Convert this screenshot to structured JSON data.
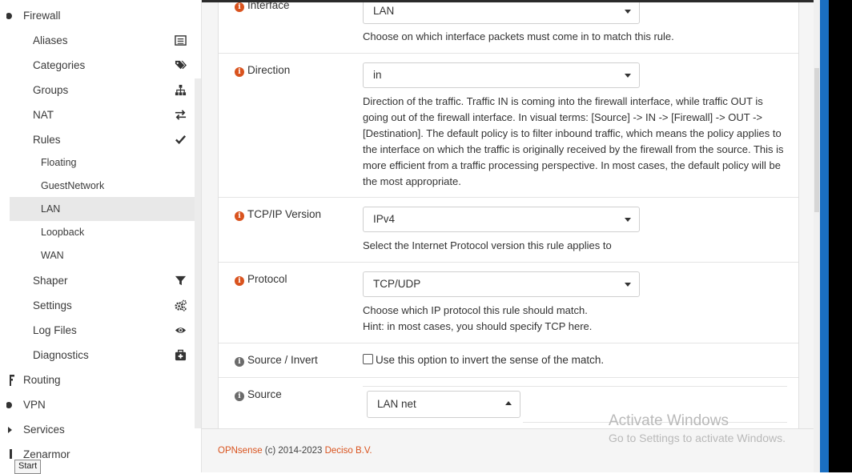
{
  "sidebar": {
    "firewall": "Firewall",
    "aliases": "Aliases",
    "categories": "Categories",
    "groups": "Groups",
    "nat": "NAT",
    "rules": "Rules",
    "floating": "Floating",
    "guestnetwork": "GuestNetwork",
    "lan": "LAN",
    "loopback": "Loopback",
    "wan": "WAN",
    "shaper": "Shaper",
    "settings": "Settings",
    "log_files": "Log Files",
    "diagnostics": "Diagnostics",
    "routing": "Routing",
    "vpn": "VPN",
    "services": "Services",
    "zenarmor": "Zenarmor"
  },
  "form": {
    "interface": {
      "label": "Interface",
      "value": "LAN",
      "help": "Choose on which interface packets must come in to match this rule."
    },
    "direction": {
      "label": "Direction",
      "value": "in",
      "help": "Direction of the traffic. Traffic IN is coming into the firewall interface, while traffic OUT is going out of the firewall interface. In visual terms: [Source] -> IN -> [Firewall] -> OUT -> [Destination]. The default policy is to filter inbound traffic, which means the policy applies to the interface on which the traffic is originally received by the firewall from the source. This is more efficient from a traffic processing perspective. In most cases, the default policy will be the most appropriate."
    },
    "tcpip": {
      "label": "TCP/IP Version",
      "value": "IPv4",
      "help": "Select the Internet Protocol version this rule applies to"
    },
    "protocol": {
      "label": "Protocol",
      "value": "TCP/UDP",
      "help1": "Choose which IP protocol this rule should match.",
      "help2": "Hint: in most cases, you should specify TCP here."
    },
    "source_invert": {
      "label": "Source / Invert",
      "checkbox_text": "Use this option to invert the sense of the match."
    },
    "source": {
      "label": "Source",
      "value": "LAN net"
    }
  },
  "footer": {
    "brand": "OPNsense",
    "middle": " (c) 2014-2023 ",
    "company": "Deciso B.V."
  },
  "watermark": {
    "line1": "Activate Windows",
    "line2": "Go to Settings to activate Windows."
  },
  "taskbar": {
    "start_tooltip": "Start"
  },
  "colors": {
    "accent": "#d9531e",
    "info_grey": "#6b6b6b",
    "windows_blue": "#1a6fc2"
  },
  "icons": {
    "aliases": "list-icon",
    "categories": "tags-icon",
    "groups": "sitemap-icon",
    "nat": "exchange-icon",
    "rules": "check-icon",
    "shaper": "filter-icon",
    "settings": "cogs-icon",
    "log_files": "eye-icon",
    "diagnostics": "medkit-icon"
  }
}
